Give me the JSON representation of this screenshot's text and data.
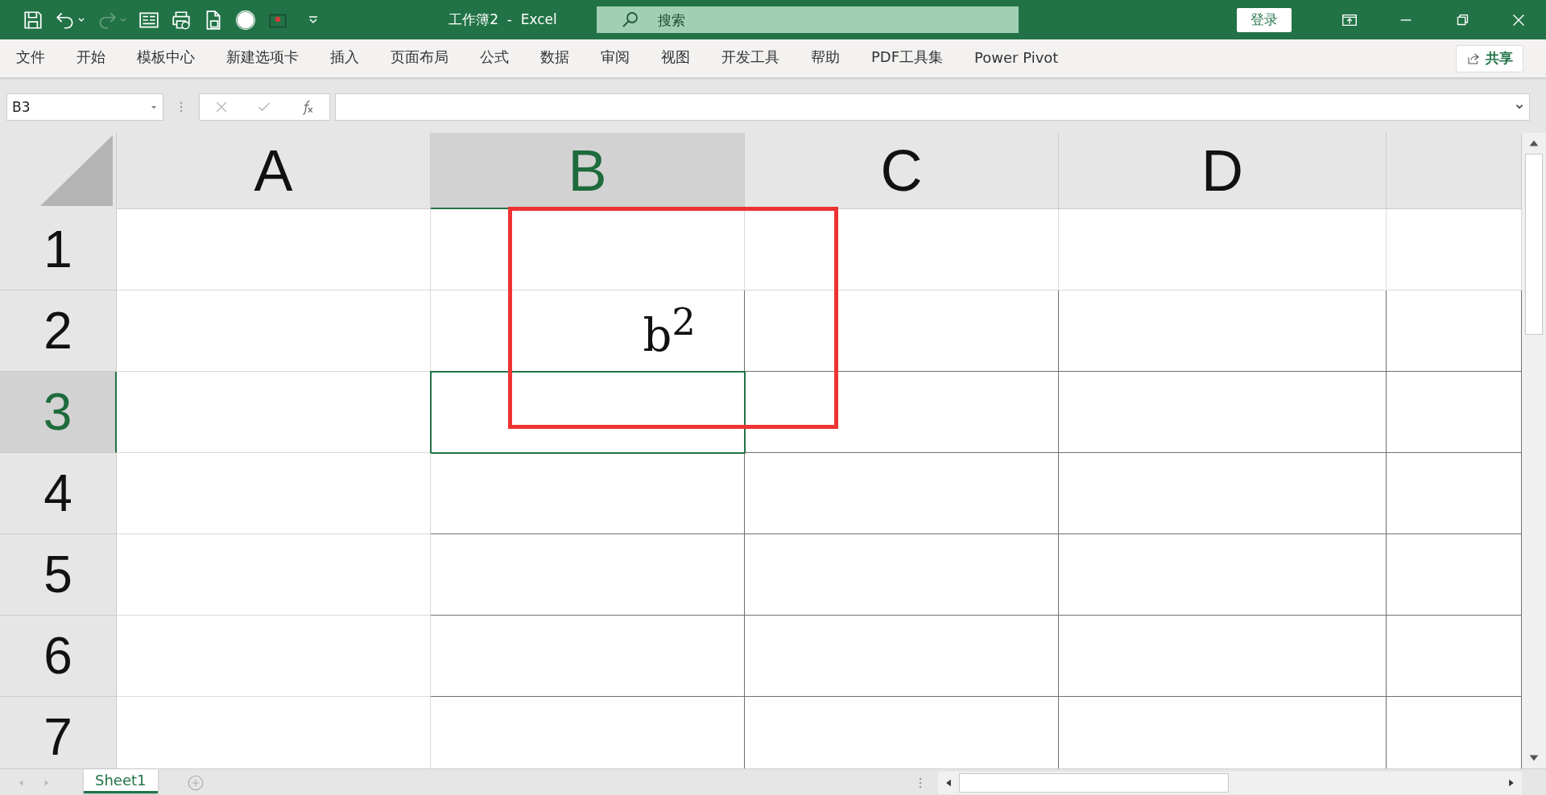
{
  "window": {
    "title": "工作簿2  -  Excel"
  },
  "search": {
    "placeholder": "搜索"
  },
  "account": {
    "login": "登录"
  },
  "menu": [
    {
      "label": "文件",
      "selected": false
    },
    {
      "label": "开始",
      "selected": false
    },
    {
      "label": "模板中心",
      "selected": false
    },
    {
      "label": "新建选项卡",
      "selected": false
    },
    {
      "label": "插入",
      "selected": false
    },
    {
      "label": "页面布局",
      "selected": false
    },
    {
      "label": "公式",
      "selected": false
    },
    {
      "label": "数据",
      "selected": false
    },
    {
      "label": "审阅",
      "selected": false
    },
    {
      "label": "视图",
      "selected": false
    },
    {
      "label": "开发工具",
      "selected": false
    },
    {
      "label": "帮助",
      "selected": false
    },
    {
      "label": "PDF工具集",
      "selected": false
    },
    {
      "label": "Power Pivot",
      "selected": false
    }
  ],
  "share": {
    "label": "共享"
  },
  "formula_bar": {
    "name_box": "B3"
  },
  "columns": [
    {
      "label": "A",
      "selected": false
    },
    {
      "label": "B",
      "selected": true
    },
    {
      "label": "C",
      "selected": false
    },
    {
      "label": "D",
      "selected": false
    }
  ],
  "rows": [
    {
      "label": "1",
      "selected": false
    },
    {
      "label": "2",
      "selected": false,
      "cells": [
        {
          "kind": "empty"
        },
        {
          "kind": "text",
          "value": "b$^{2}$"
        },
        {
          "kind": "empty"
        },
        {
          "kind": "empty"
        }
      ]
    },
    {
      "label": "3",
      "selected": true
    },
    {
      "label": "4",
      "selected": false
    },
    {
      "label": "5",
      "selected": false
    },
    {
      "label": "6",
      "selected": false
    },
    {
      "label": "7",
      "selected": false
    }
  ],
  "sheets": [
    {
      "label": "Sheet1",
      "selected": true
    }
  ]
}
